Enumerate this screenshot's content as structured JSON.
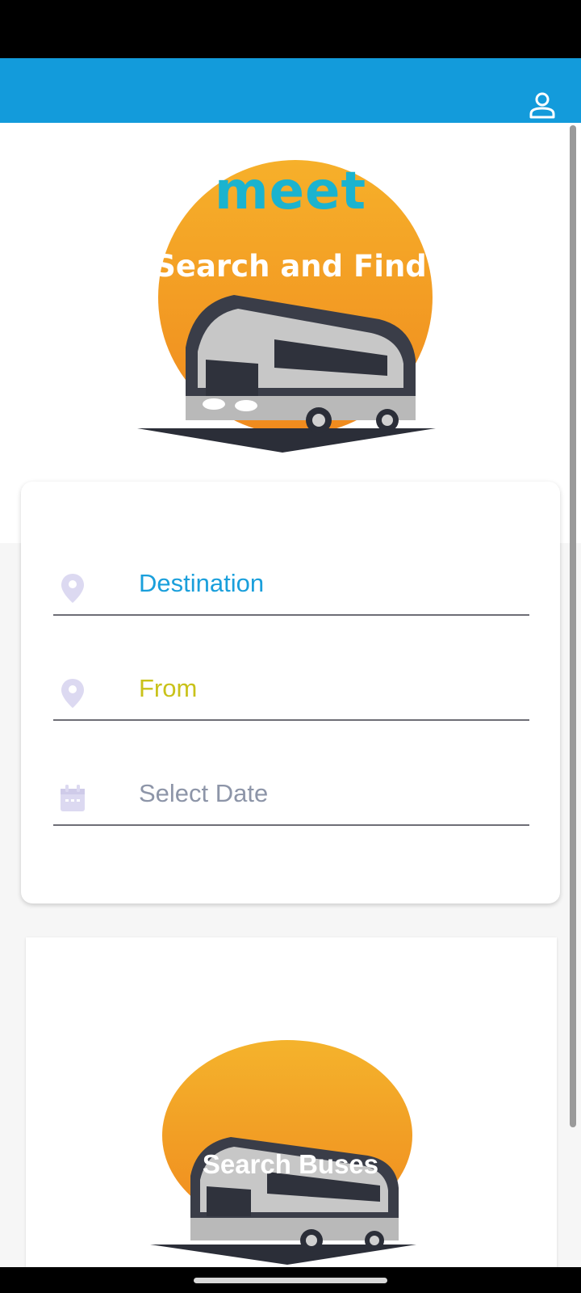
{
  "app": {
    "brand": "meet",
    "tagline": "Search and Find"
  },
  "header": {
    "profile_icon": "person-outline-icon",
    "accent_color": "#139bdb"
  },
  "form": {
    "destination": {
      "label": "Destination",
      "icon": "location-pin-icon",
      "color": "#1a9fdb"
    },
    "from": {
      "label": "From",
      "icon": "location-pin-icon",
      "color": "#c9c21a"
    },
    "date": {
      "label": "Select Date",
      "icon": "calendar-icon",
      "color": "#8d95a8"
    }
  },
  "search_button": {
    "label": "Search Buses"
  }
}
